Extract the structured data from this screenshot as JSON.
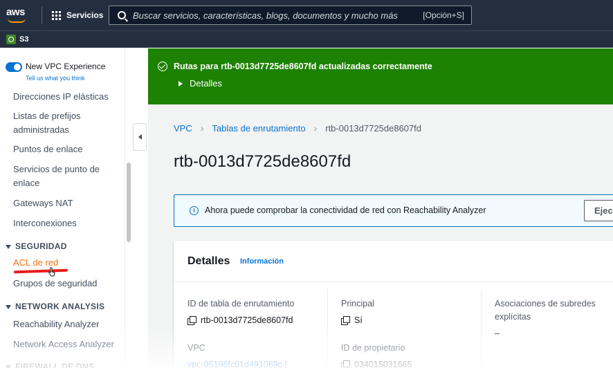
{
  "topnav": {
    "logo_text": "aws",
    "services_label": "Servicios",
    "search_placeholder": "Buscar servicios, características, blogs, documentos y mucho más",
    "search_shortcut": "[Opción+S]"
  },
  "favorites": {
    "s3_label": "S3"
  },
  "sidebar": {
    "vpc_title": "New VPC Experience",
    "vpc_feedback": "Tell us what you think",
    "items": [
      "Direcciones IP elásticas",
      "Listas de prefijos administradas",
      "Puntos de enlace",
      "Servicios de punto de enlace",
      "Gateways NAT",
      "Interconexiones"
    ],
    "sections": {
      "security": "SEGURIDAD",
      "network_analysis": "NETWORK ANALYSIS",
      "firewall": "FIREWALL DE DNS"
    },
    "security_items": [
      "ACL de red",
      "Grupos de seguridad"
    ],
    "analysis_items": [
      "Reachability Analyzer",
      "Network Access Analyzer"
    ]
  },
  "flash": {
    "message": "Rutas para rtb-0013d7725de8607fd actualizadas correctamente",
    "details_label": "Detalles"
  },
  "breadcrumb": [
    "VPC",
    "Tablas de enrutamiento",
    "rtb-0013d7725de8607fd"
  ],
  "page_title": "rtb-0013d7725de8607fd",
  "info_panel": {
    "text": "Ahora puede comprobar la conectividad de red con Reachability Analyzer",
    "button_label": "Ejec"
  },
  "details": {
    "title": "Detalles",
    "info_link": "Información",
    "fields": {
      "route_table_id_label": "ID de tabla de enrutamiento",
      "route_table_id_value": "rtb-0013d7725de8607fd",
      "main_label": "Principal",
      "main_value": "Sí",
      "subnet_assoc_label": "Asociaciones de subredes explícitas",
      "subnet_assoc_value": "–",
      "vpc_label": "VPC",
      "vpc_value": "vpc-05196fc61d491069c |",
      "owner_label": "ID de propietario",
      "owner_value": "034015031665"
    }
  },
  "colors": {
    "nav_bg": "#232f3e",
    "success_green": "#1d8102",
    "link_blue": "#0972d3",
    "active_orange": "#ec7211",
    "annotation_red": "#e81c1c"
  }
}
